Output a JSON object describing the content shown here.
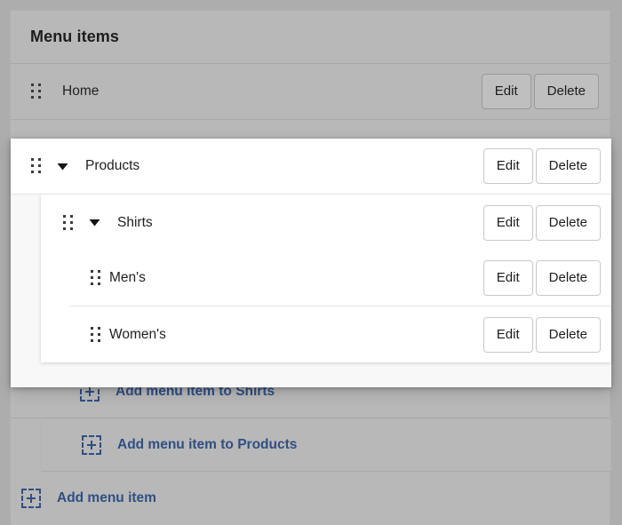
{
  "panel": {
    "title": "Menu items"
  },
  "colors": {
    "page_background": "#adadad",
    "panel_background": "#b8b8b8",
    "card_background": "#ffffff",
    "card_body_background": "#f8f8f8",
    "accent_link": "#2f4f82",
    "button_border": "#c9c9c9",
    "text": "#1d1d1d"
  },
  "buttons": {
    "edit_label": "Edit",
    "delete_label": "Delete"
  },
  "icons": {
    "drag_handle": "drag-handle-icon",
    "caret_expanded": "chevron-down-icon",
    "add": "add-dashed-square-icon"
  },
  "items": [
    {
      "id": "home",
      "label": "Home",
      "depth": 0,
      "expandable": false,
      "state": "dimmed"
    },
    {
      "id": "products",
      "label": "Products",
      "depth": 0,
      "expandable": true,
      "expanded": true,
      "state": "dragging"
    },
    {
      "id": "shirts",
      "label": "Shirts",
      "depth": 1,
      "expandable": true,
      "expanded": true,
      "state": "normal"
    },
    {
      "id": "mens",
      "label": "Men's",
      "depth": 2,
      "expandable": false,
      "state": "normal"
    },
    {
      "id": "womens",
      "label": "Women's",
      "depth": 2,
      "expandable": false,
      "state": "normal"
    }
  ],
  "add_links": [
    {
      "id": "add-to-shirts",
      "label": "Add menu item to Shirts",
      "depth": 2
    },
    {
      "id": "add-to-products",
      "label": "Add menu item to Products",
      "depth": 1
    },
    {
      "id": "add-root",
      "label": "Add menu item",
      "depth": 0
    }
  ]
}
